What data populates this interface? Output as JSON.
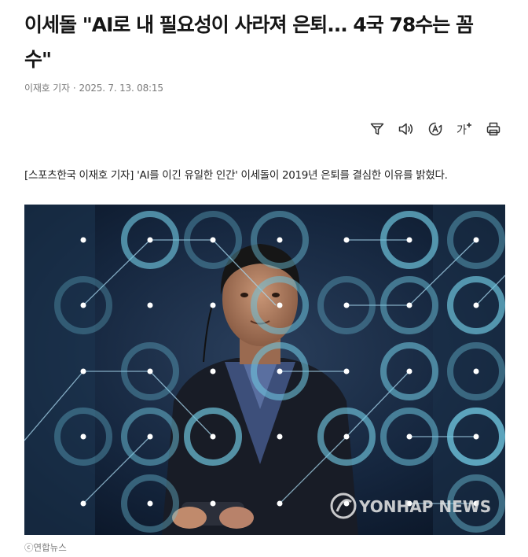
{
  "article": {
    "headline": "이세돌 \"AI로 내 필요성이 사라져 은퇴... 4국 78수는 꼼수\"",
    "reporter": "이재호 기자",
    "date": "2025. 7. 13. 08:15",
    "lede": "[스포츠한국 이재호 기자] 'AI를 이긴 유일한 인간' 이세돌이 2019년 은퇴를 결심한 이유를 밝혔다."
  },
  "toolbar": {
    "icons": [
      "filter-icon",
      "speaker-icon",
      "translate-icon",
      "font-size-icon",
      "print-icon"
    ],
    "font_size_glyph": "가"
  },
  "photo": {
    "watermark": "YONHAP NEWS",
    "credit": "ⓒ연합뉴스"
  },
  "colors": {
    "headline": "#151515",
    "meta": "#7a7a7a",
    "icon": "#333333",
    "photo_bg": "#0e1b2e",
    "ring": "#6ec3dc"
  }
}
